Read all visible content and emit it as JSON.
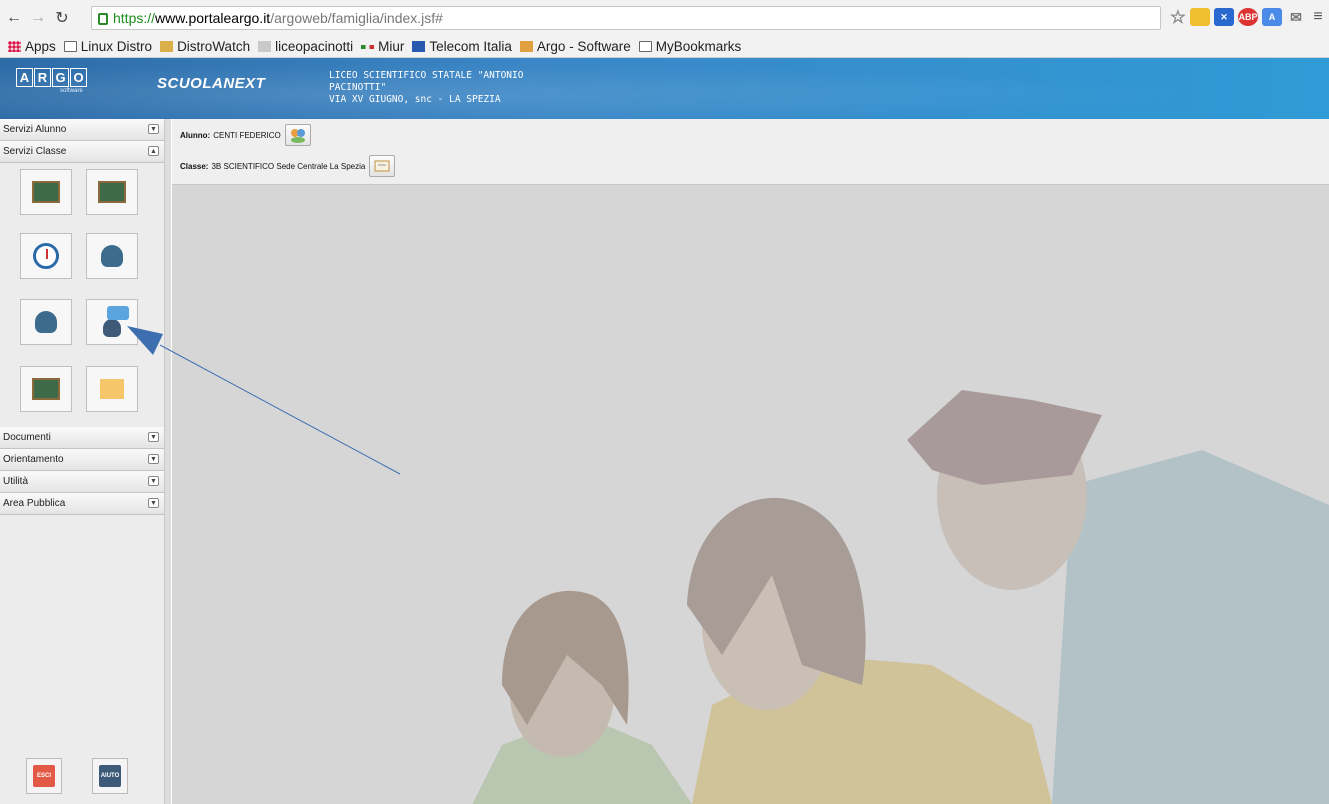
{
  "browser": {
    "url_scheme": "https://",
    "url_host": "www.portaleargo.it",
    "url_path": "/argoweb/famiglia/index.jsf#",
    "bookmarks": [
      "Apps",
      "Linux Distro",
      "DistroWatch",
      "liceopacinotti",
      "Miur",
      "Telecom Italia",
      "Argo - Software",
      "MyBookmarks"
    ]
  },
  "header": {
    "logo_letters": [
      "A",
      "R",
      "G",
      "O"
    ],
    "logo_sub": "software",
    "brand": "SCUOLANEXT",
    "school_lines": [
      "LICEO SCIENTIFICO STATALE \"ANTONIO",
      "PACINOTTI\"",
      "VIA XV GIUGNO, snc - LA SPEZIA"
    ]
  },
  "sidebar": {
    "sections_top": [
      "Servizi Alunno",
      "Servizi Classe"
    ],
    "sections_bottom": [
      "Documenti",
      "Orientamento",
      "Utilità",
      "Area Pubblica"
    ],
    "tiles": [
      "orario-classe-icon",
      "registro-icon",
      "clock-board-icon",
      "docenti-classe-icon",
      "people-building-icon",
      "bacheca-chat-icon",
      "compiti-board-icon",
      "note-board-icon"
    ],
    "exit_label": "ESCI",
    "help_label": "AIUTO"
  },
  "main": {
    "student_label": "Alunno:",
    "student_value": "CENTI FEDERICO",
    "class_label": "Classe:",
    "class_value": "3B SCIENTIFICO Sede Centrale La Spezia"
  },
  "colors": {
    "header": "#3a86c6",
    "arrow": "#3d6fb0",
    "exit": "#e25a45",
    "help": "#3d5a78"
  }
}
